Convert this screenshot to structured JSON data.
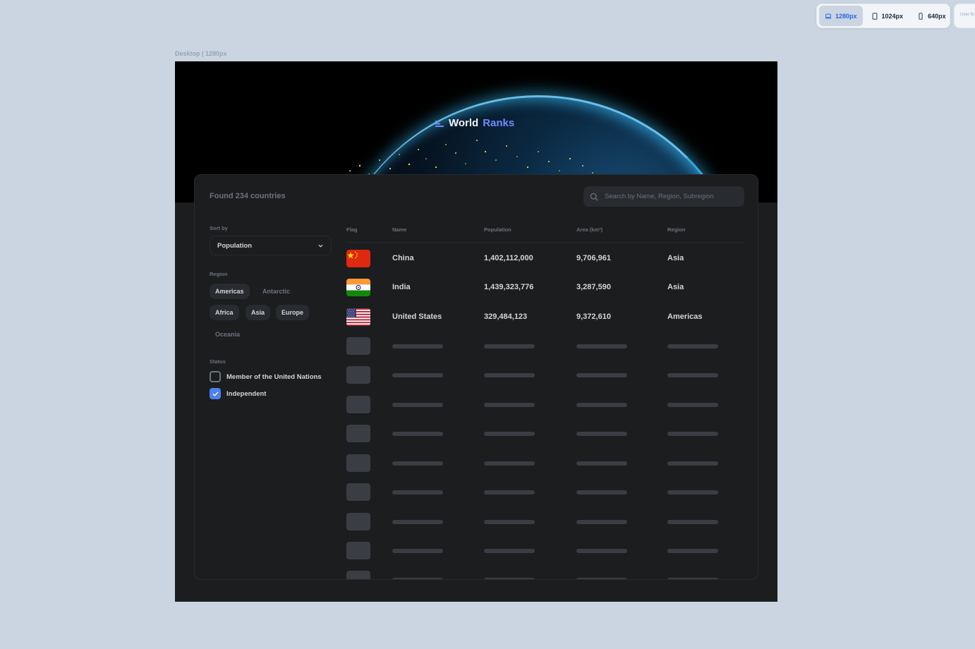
{
  "devices": [
    {
      "label": "1280px",
      "icon": "laptop-icon"
    },
    {
      "label": "1024px",
      "icon": "tablet-icon"
    },
    {
      "label": "640px",
      "icon": "phone-icon"
    }
  ],
  "user_stub": "User Si",
  "frame_label": "Desktop | 1280px",
  "logo": {
    "part1": "World",
    "part2": "Ranks"
  },
  "found_text": "Found 234 countries",
  "search": {
    "placeholder": "Search by Name, Region, Subregion"
  },
  "sort": {
    "label": "Sort by",
    "value": "Population"
  },
  "region": {
    "label": "Region",
    "chips": [
      {
        "label": "Americas",
        "selected": true
      },
      {
        "label": "Antarctic",
        "selected": false
      },
      {
        "label": "Africa",
        "selected": true
      },
      {
        "label": "Asia",
        "selected": true
      },
      {
        "label": "Europe",
        "selected": true
      },
      {
        "label": "Oceania",
        "selected": false
      }
    ]
  },
  "status": {
    "label": "Status",
    "options": [
      {
        "label": "Member of the United Nations",
        "checked": false
      },
      {
        "label": "Independent",
        "checked": true
      }
    ]
  },
  "table": {
    "headers": [
      "Flag",
      "Name",
      "Population",
      "Area (km²)",
      "Region"
    ],
    "rows": [
      {
        "flag": "china-flag",
        "name": "China",
        "population": "1,402,112,000",
        "area": "9,706,961",
        "region": "Asia"
      },
      {
        "flag": "india-flag",
        "name": "India",
        "population": "1,439,323,776",
        "area": "3,287,590",
        "region": "Asia"
      },
      {
        "flag": "usa-flag",
        "name": "United States",
        "population": "329,484,123",
        "area": "9,372,610",
        "region": "Americas"
      }
    ],
    "skeleton_rows": 9
  },
  "colors": {
    "accent": "#4e80ee",
    "panel": "#1b1d1f",
    "surface": "#282b30",
    "muted": "#6c727f",
    "text": "#d2d5da"
  }
}
